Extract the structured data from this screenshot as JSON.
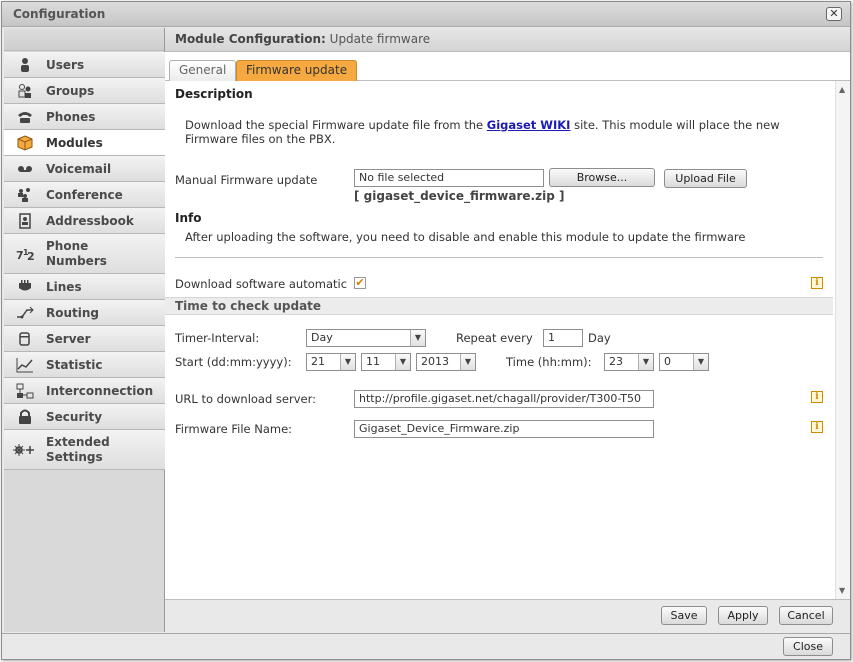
{
  "window": {
    "title": "Configuration",
    "close_label": "Close"
  },
  "sidebar": {
    "items": [
      {
        "label": "Users",
        "icon": "user-icon"
      },
      {
        "label": "Groups",
        "icon": "group-icon"
      },
      {
        "label": "Phones",
        "icon": "phone-icon"
      },
      {
        "label": "Modules",
        "icon": "module-icon",
        "active": true
      },
      {
        "label": "Voicemail",
        "icon": "voicemail-icon"
      },
      {
        "label": "Conference",
        "icon": "conference-icon"
      },
      {
        "label": "Addressbook",
        "icon": "addressbook-icon"
      },
      {
        "label": "Phone\nNumbers",
        "icon": "phone-numbers-icon"
      },
      {
        "label": "Lines",
        "icon": "lines-icon"
      },
      {
        "label": "Routing",
        "icon": "routing-icon"
      },
      {
        "label": "Server",
        "icon": "server-icon"
      },
      {
        "label": "Statistic",
        "icon": "statistic-icon"
      },
      {
        "label": "Interconnection",
        "icon": "interconnection-icon"
      },
      {
        "label": "Security",
        "icon": "lock-icon"
      },
      {
        "label": "Extended\nSettings",
        "icon": "extended-settings-icon"
      }
    ]
  },
  "main": {
    "header_label": "Module Configuration:",
    "header_value": "Update firmware",
    "tabs": [
      {
        "label": "General"
      },
      {
        "label": "Firmware update",
        "active": true
      }
    ]
  },
  "form": {
    "description_heading": "Description",
    "description_pre": "Download the special Firmware update file from the ",
    "description_link": "Gigaset WIKI",
    "description_post_line1": " site. This module will place the new",
    "description_line2": "Firmware files on the PBX.",
    "manual_label": "Manual Firmware update",
    "file_value": "No file selected",
    "browse_label": "Browse...",
    "upload_label": "Upload File",
    "file_name_hint": "[ gigaset_device_firmware.zip ]",
    "info_heading": "Info",
    "info_text": "After uploading the software, you need to disable and enable this module to update the firmware",
    "download_auto_label": "Download software automatic",
    "download_auto_checked": "✔",
    "time_section": "Time to check update",
    "timer_label": "Timer-Interval:",
    "timer_value": "Day",
    "repeat_label": "Repeat every",
    "repeat_value": "1",
    "repeat_unit": "Day",
    "start_label": "Start (dd:mm:yyyy):",
    "start_day": "21",
    "start_month": "11",
    "start_year": "2013",
    "time_label": "Time (hh:mm):",
    "time_hour": "23",
    "time_minute": "0",
    "url_label": "URL to download server:",
    "url_value": "http://profile.gigaset.net/chagall/provider/T300-T50",
    "fw_name_label": "Firmware File Name:",
    "fw_name_value": "Gigaset_Device_Firmware.zip",
    "info_glyph": "i"
  },
  "footer": {
    "save": "Save",
    "apply": "Apply",
    "cancel": "Cancel"
  },
  "colors": {
    "accent": "#f5a940",
    "link": "#1a1ab5"
  }
}
